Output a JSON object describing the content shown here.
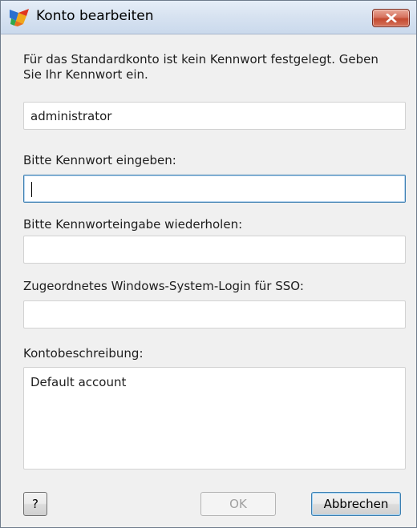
{
  "window": {
    "title": "Konto bearbeiten",
    "app_icon": "avg-logo-icon",
    "close_icon": "close-icon",
    "close_color": "#c8553a"
  },
  "dialog": {
    "intro_text": "Für das Standardkonto ist kein Kennwort festgelegt. Geben Sie Ihr Kennwort ein.",
    "username_value": "administrator",
    "password_label": "Bitte Kennwort eingeben:",
    "password_value": "",
    "password_confirm_label": "Bitte Kennworteingabe wiederholen:",
    "password_confirm_value": "",
    "windows_login_label": "Zugeordnetes Windows-System-Login für SSO:",
    "windows_login_value": "",
    "description_label": "Kontobeschreibung:",
    "description_value": "Default account"
  },
  "buttons": {
    "help_label": "?",
    "ok_label": "OK",
    "cancel_label": "Abbrechen"
  }
}
